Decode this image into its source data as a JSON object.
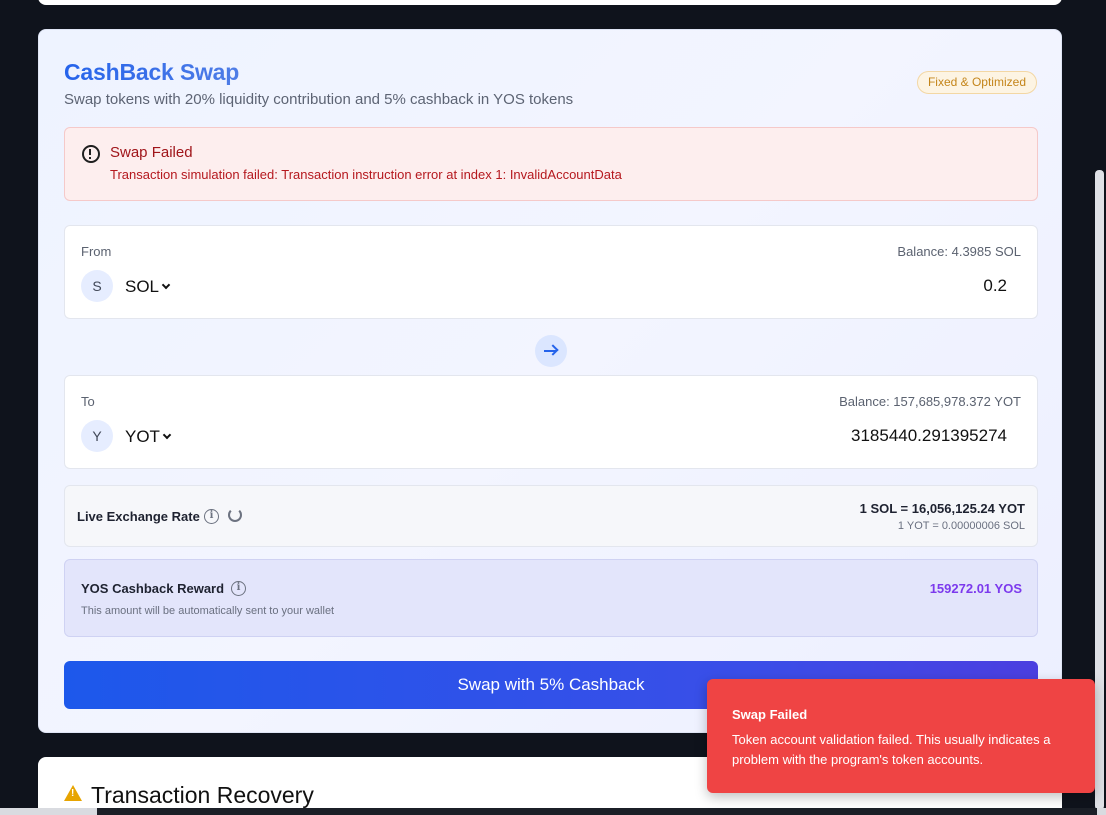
{
  "swap": {
    "title": "CashBack Swap",
    "subtitle": "Swap tokens with 20% liquidity contribution and 5% cashback in YOS tokens",
    "badge": "Fixed & Optimized",
    "error": {
      "title": "Swap Failed",
      "message": "Transaction simulation failed: Transaction instruction error at index 1: InvalidAccountData"
    },
    "from": {
      "label": "From",
      "balance": "Balance: 4.3985 SOL",
      "avatar": "S",
      "token": "SOL",
      "amount": "0.2"
    },
    "to": {
      "label": "To",
      "balance": "Balance: 157,685,978.372 YOT",
      "avatar": "Y",
      "token": "YOT",
      "amount": "3185440.291395274"
    },
    "rate": {
      "label": "Live Exchange Rate",
      "main": "1 SOL = 16,056,125.24 YOT",
      "sub": "1 YOT = 0.00000006 SOL"
    },
    "cashback": {
      "label": "YOS Cashback Reward",
      "note": "This amount will be automatically sent to your wallet",
      "value": "159272.01 YOS"
    },
    "button_label": "Swap with 5% Cashback"
  },
  "recovery": {
    "title": "Transaction Recovery"
  },
  "toast": {
    "title": "Swap Failed",
    "message": "Token account validation failed. This usually indicates a problem with the program's token accounts."
  },
  "icons": {
    "error": "alert-circle-icon",
    "swap_direction": "arrow-right-icon",
    "info": "info-icon",
    "refresh": "refresh-icon",
    "warning": "warning-triangle-icon"
  },
  "colors": {
    "accent": "#2563eb",
    "error_bg": "#fdeeee",
    "error_text": "#a0151a",
    "cashback_value": "#7c3aed",
    "toast_bg": "#ef4444",
    "badge_text": "#c4851a"
  }
}
